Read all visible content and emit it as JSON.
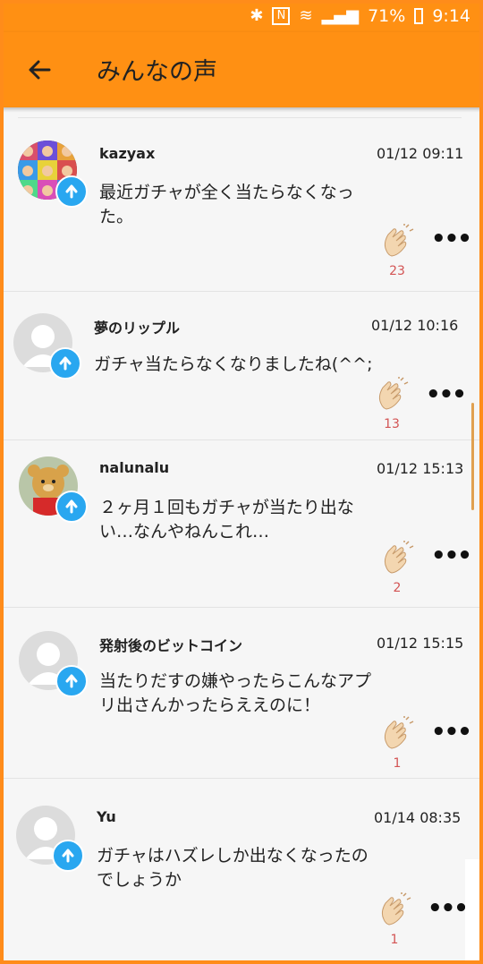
{
  "statusbar": {
    "battery": "71%",
    "time": "9:14"
  },
  "appbar": {
    "title": "みんなの声"
  },
  "posts": [
    {
      "name": "kazyax",
      "time": "01/12 09:11",
      "message": "最近ガチャが全く当たらなくなった。",
      "claps": "23"
    },
    {
      "name": "夢のリップル",
      "time": "01/12 10:16",
      "message": "ガチャ当たらなくなりましたね(^^;",
      "claps": "13"
    },
    {
      "name": "nalunalu",
      "time": "01/12 15:13",
      "message": "２ヶ月１回もガチャが当たり出ない…なんやねんこれ…",
      "claps": "2"
    },
    {
      "name": "発射後のビットコイン",
      "time": "01/12 15:15",
      "message": "当たりだすの嫌やったらこんなアプリ出さんかったらええのに！",
      "claps": "1"
    },
    {
      "name": "Yu",
      "time": "01/14 08:35",
      "message": "ガチャはハズレしか出なくなったのでしょうか",
      "claps": "1"
    }
  ],
  "icons": {
    "back": "arrow-left-icon",
    "upload": "upload-arrow-icon",
    "clap": "clapping-hands-icon",
    "more": "more-dots-icon"
  },
  "colors": {
    "appbar": "#ff9013",
    "badge": "#29a7f0",
    "count": "#d35454"
  }
}
